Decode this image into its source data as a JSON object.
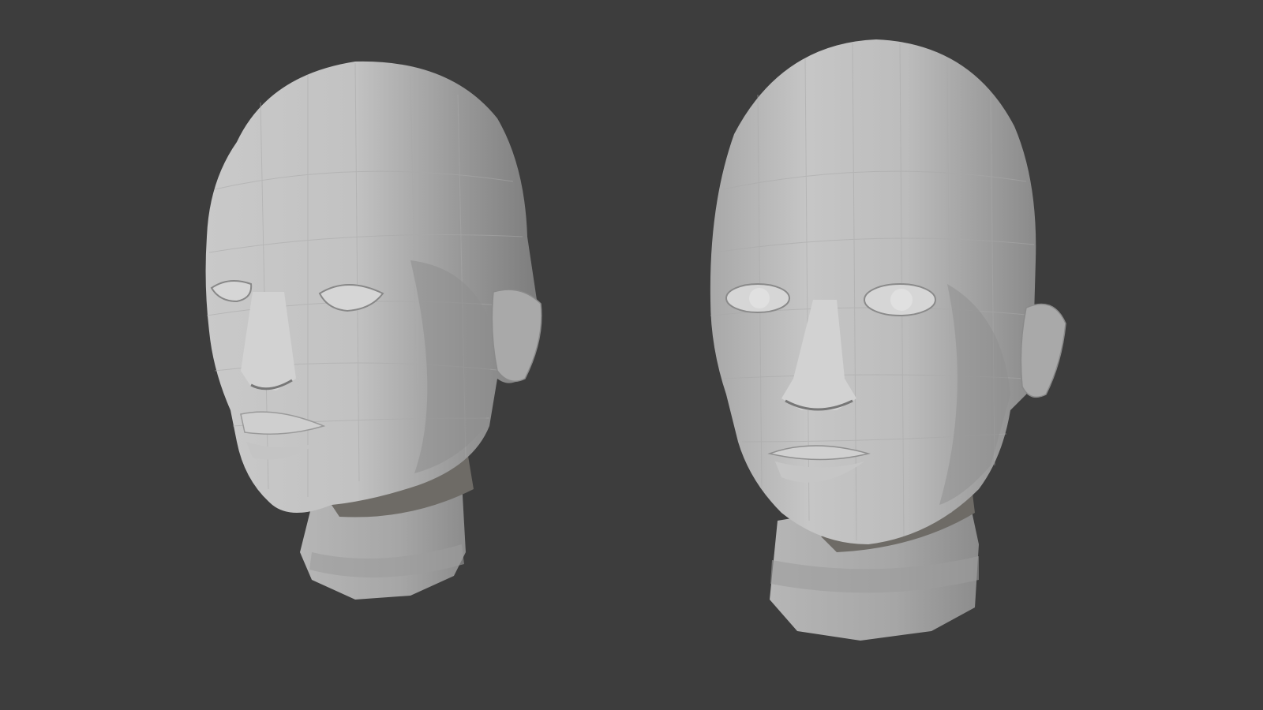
{
  "scene": {
    "background_color": "#3d3d3d",
    "mesh_color": "#bdbdbd",
    "mesh_shadow_color": "#6e6b66",
    "mesh_highlight_color": "#dcdcdc",
    "objects": [
      {
        "name": "low-poly-head-left",
        "view": "three-quarter"
      },
      {
        "name": "low-poly-head-right",
        "view": "front"
      }
    ]
  }
}
